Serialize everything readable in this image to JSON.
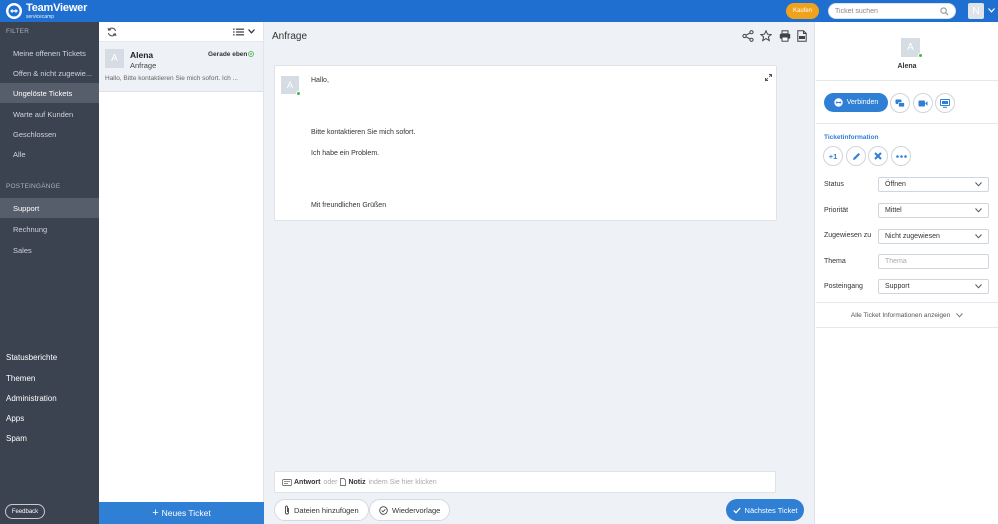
{
  "topbar": {
    "brand_main": "TeamViewer",
    "brand_sub": "servicecamp",
    "buy_label": "Kaufen",
    "search_placeholder": "Ticket suchen",
    "user_initial": "N",
    "accent_color": "#1f6fd0",
    "buy_color": "#f0a21d"
  },
  "sidebar": {
    "filter_title": "FILTER",
    "filters": [
      {
        "label": "Meine offenen Tickets",
        "active": false
      },
      {
        "label": "Offen & nicht zugewie...",
        "active": false
      },
      {
        "label": "Ungelöste Tickets",
        "active": true
      },
      {
        "label": "Warte auf Kunden",
        "active": false
      },
      {
        "label": "Geschlossen",
        "active": false
      },
      {
        "label": "Alle",
        "active": false
      }
    ],
    "inbox_title": "POSTEINGÄNGE",
    "inboxes": [
      {
        "label": "Support",
        "active": true
      },
      {
        "label": "Rechnung",
        "active": false
      },
      {
        "label": "Sales",
        "active": false
      }
    ],
    "sections": [
      "Statusberichte",
      "Themen",
      "Administration",
      "Apps",
      "Spam"
    ],
    "feedback_label": "Feedback"
  },
  "ticket_list": {
    "items": [
      {
        "avatar": "A",
        "name": "Alena",
        "subject": "Anfrage",
        "time": "Gerade eben",
        "preview": "Hallo, Bitte kontaktieren Sie mich sofort. Ich ..."
      }
    ],
    "new_ticket_label": "Neues Ticket"
  },
  "main": {
    "title": "Anfrage",
    "message": {
      "avatar": "A",
      "lines": [
        "Hallo,",
        "Bitte kontaktieren Sie  mich sofort.",
        "Ich habe ein Problem.",
        "Mit freundlichen Grüßen"
      ]
    },
    "reply": {
      "answer": "Antwort",
      "or": "oder",
      "note": "Notiz",
      "hint": "indem Sie hier klicken"
    },
    "add_files_label": "Dateien hinzufügen",
    "followup_label": "Wiedervorlage",
    "next_ticket_label": "Nächstes Ticket"
  },
  "details": {
    "avatar": "A",
    "name": "Alena",
    "connect_label": "Verbinden",
    "section_title": "Ticketinformation",
    "plus_one": "+1",
    "fields": {
      "status_label": "Status",
      "status_value": "Öffnen",
      "priority_label": "Priorität",
      "priority_value": "Mittel",
      "assigned_label": "Zugewiesen zu",
      "assigned_value": "Nicht zugewiesen",
      "topic_label": "Thema",
      "topic_placeholder": "Thema",
      "inbox_label": "Posteingang",
      "inbox_value": "Support"
    },
    "all_info_label": "Alle Ticket Informationen anzeigen"
  }
}
